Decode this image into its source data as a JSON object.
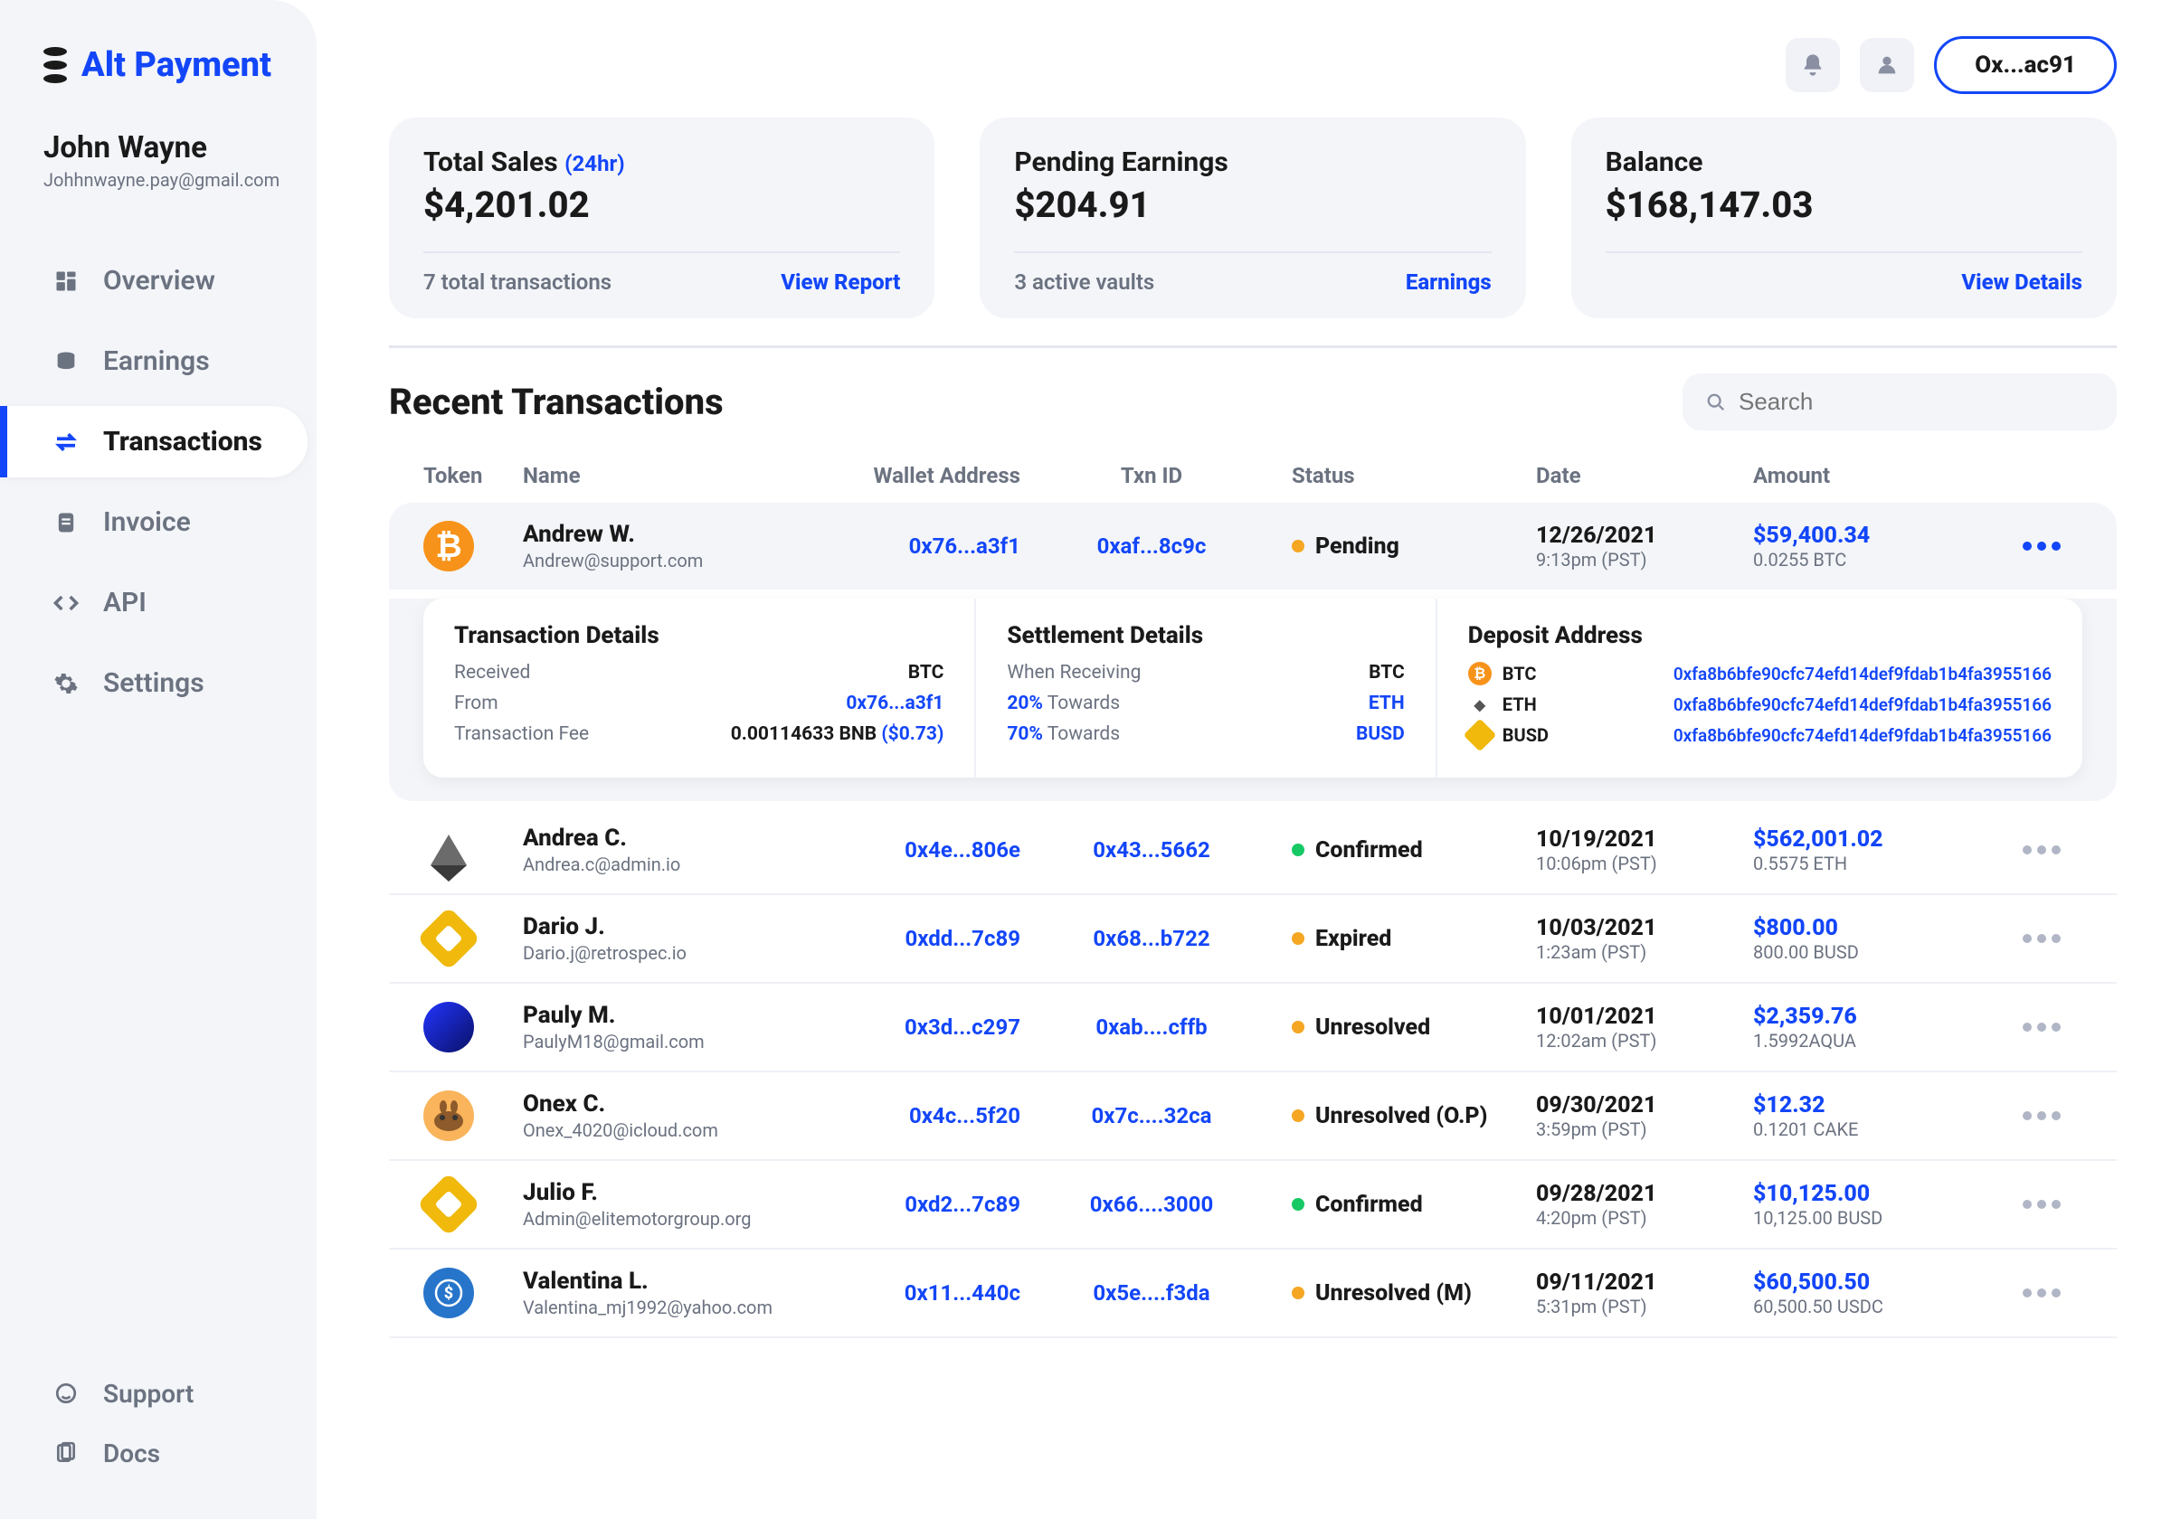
{
  "brand": "Alt Payment",
  "user": {
    "name": "John Wayne",
    "email": "Johhnwayne.pay@gmail.com"
  },
  "wallet_chip": "Ox...ac91",
  "nav": {
    "overview": "Overview",
    "earnings": "Earnings",
    "transactions": "Transactions",
    "invoice": "Invoice",
    "api": "API",
    "settings": "Settings",
    "support": "Support",
    "docs": "Docs"
  },
  "stats": {
    "total_sales": {
      "title": "Total Sales",
      "suffix": "(24hr)",
      "value": "$4,201.02",
      "meta": "7 total transactions",
      "link": "View Report"
    },
    "pending": {
      "title": "Pending Earnings",
      "value": "$204.91",
      "meta": "3 active vaults",
      "link": "Earnings"
    },
    "balance": {
      "title": "Balance",
      "value": "$168,147.03",
      "meta": "",
      "link": "View Details"
    }
  },
  "section_title": "Recent Transactions",
  "search_placeholder": "Search",
  "columns": {
    "token": "Token",
    "name": "Name",
    "wallet": "Wallet Address",
    "txn": "Txn ID",
    "status": "Status",
    "date": "Date",
    "amount": "Amount"
  },
  "rows": [
    {
      "token": "btc",
      "name": "Andrew W.",
      "email": "Andrew@support.com",
      "wallet": "0x76...a3f1",
      "txn": "0xaf...8c9c",
      "status": "Pending",
      "dot": "y",
      "date": "12/26/2021",
      "time": "9:13pm (PST)",
      "amount": "$59,400.34",
      "amount_sub": "0.0255 BTC",
      "expanded": true
    },
    {
      "token": "eth",
      "name": "Andrea C.",
      "email": "Andrea.c@admin.io",
      "wallet": "0x4e...806e",
      "txn": "0x43...5662",
      "status": "Confirmed",
      "dot": "g",
      "date": "10/19/2021",
      "time": "10:06pm (PST)",
      "amount": "$562,001.02",
      "amount_sub": "0.5575 ETH"
    },
    {
      "token": "busd",
      "name": "Dario J.",
      "email": "Dario.j@retrospec.io",
      "wallet": "0xdd...7c89",
      "txn": "0x68...b722",
      "status": "Expired",
      "dot": "o",
      "date": "10/03/2021",
      "time": "1:23am (PST)",
      "amount": "$800.00",
      "amount_sub": "800.00 BUSD"
    },
    {
      "token": "aqua",
      "name": "Pauly M.",
      "email": "PaulyM18@gmail.com",
      "wallet": "0x3d...c297",
      "txn": "0xab....cffb",
      "status": "Unresolved",
      "dot": "o",
      "date": "10/01/2021",
      "time": "12:02am (PST)",
      "amount": "$2,359.76",
      "amount_sub": "1.5992AQUA"
    },
    {
      "token": "cake",
      "name": "Onex C.",
      "email": "Onex_4020@icloud.com",
      "wallet": "0x4c...5f20",
      "txn": "0x7c....32ca",
      "status": "Unresolved (O.P)",
      "dot": "o",
      "date": "09/30/2021",
      "time": "3:59pm (PST)",
      "amount": "$12.32",
      "amount_sub": "0.1201 CAKE"
    },
    {
      "token": "busd",
      "name": "Julio F.",
      "email": "Admin@elitemotorgroup.org",
      "wallet": "0xd2...7c89",
      "txn": "0x66....3000",
      "status": "Confirmed",
      "dot": "g",
      "date": "09/28/2021",
      "time": "4:20pm (PST)",
      "amount": "$10,125.00",
      "amount_sub": "10,125.00 BUSD"
    },
    {
      "token": "usdc",
      "name": "Valentina L.",
      "email": "Valentina_mj1992@yahoo.com",
      "wallet": "0x11...440c",
      "txn": "0x5e....f3da",
      "status": "Unresolved (M)",
      "dot": "o",
      "date": "09/11/2021",
      "time": "5:31pm (PST)",
      "amount": "$60,500.50",
      "amount_sub": "60,500.50 USDC"
    }
  ],
  "details": {
    "txn": {
      "title": "Transaction Details",
      "received_label": "Received",
      "received_val": "BTC",
      "from_label": "From",
      "from_val": "0x76...a3f1",
      "fee_label": "Transaction Fee",
      "fee_val": "0.00114633 BNB ",
      "fee_usd": "($0.73)"
    },
    "settle": {
      "title": "Settlement Details",
      "when_label": "When Receiving",
      "when_val": "BTC",
      "row1_label": "20% Towards",
      "row1_val": "ETH",
      "row2_label": "70% Towards",
      "row2_val": "BUSD"
    },
    "deposit": {
      "title": "Deposit Address",
      "btc": "BTC",
      "eth": "ETH",
      "busd": "BUSD",
      "hash": "0xfa8b6bfe90cfc74efd14def9fdab1b4fa3955166"
    }
  }
}
